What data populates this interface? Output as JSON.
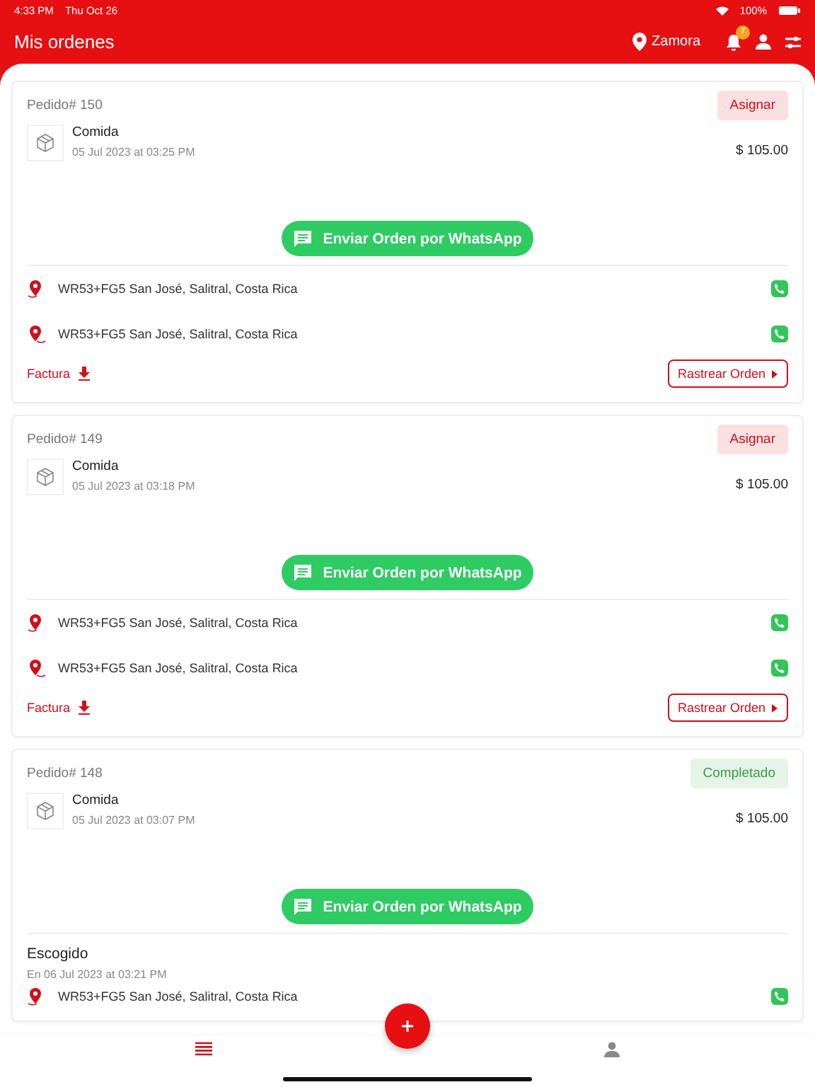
{
  "status_bar": {
    "time": "4:33 PM",
    "date": "Thu Oct 26",
    "battery": "100%"
  },
  "header": {
    "title": "Mis ordenes",
    "location": "Zamora",
    "notification_count": "7"
  },
  "orders": [
    {
      "number": "Pedido# 150",
      "status": {
        "kind": "assign",
        "label": "Asignar"
      },
      "item": "Comida",
      "date": "05 Jul 2023 at 03:25 PM",
      "price": "$ 105.00",
      "whatsapp": "Enviar Orden por WhatsApp",
      "addresses": [
        "WR53+FG5 San José, Salitral, Costa Rica",
        "WR53+FG5 San José, Salitral, Costa Rica"
      ],
      "invoice": "Factura",
      "track": "Rastrear Orden"
    },
    {
      "number": "Pedido# 149",
      "status": {
        "kind": "assign",
        "label": "Asignar"
      },
      "item": "Comida",
      "date": "05 Jul 2023 at 03:18 PM",
      "price": "$ 105.00",
      "whatsapp": "Enviar Orden por WhatsApp",
      "addresses": [
        "WR53+FG5 San José, Salitral, Costa Rica",
        "WR53+FG5 San José, Salitral, Costa Rica"
      ],
      "invoice": "Factura",
      "track": "Rastrear Orden"
    },
    {
      "number": "Pedido# 148",
      "status": {
        "kind": "completed",
        "label": "Completado"
      },
      "item": "Comida",
      "date": "05 Jul 2023 at 03:07 PM",
      "price": "$ 105.00",
      "whatsapp": "Enviar Orden por WhatsApp",
      "picked": {
        "title": "Escogido",
        "date": "En 06 Jul 2023 at 03:21 PM"
      },
      "addresses": [
        "WR53+FG5 San José, Salitral, Costa Rica"
      ]
    }
  ],
  "bottom_nav": [
    {
      "kind": "list",
      "selected": true
    },
    {
      "kind": "profile",
      "selected": false
    }
  ]
}
